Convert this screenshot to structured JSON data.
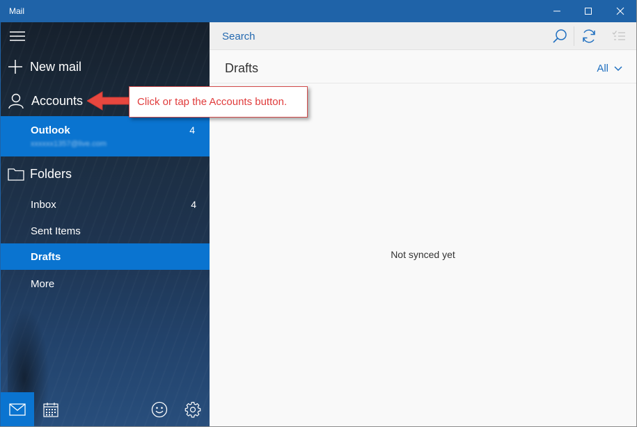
{
  "window": {
    "title": "Mail",
    "controls": [
      "minimize-icon",
      "maximize-icon",
      "close-icon"
    ]
  },
  "sidebar": {
    "menu_icon": "hamburger-icon",
    "new_mail": {
      "label": "New mail",
      "icon": "plus-icon"
    },
    "accounts": {
      "label": "Accounts",
      "icon": "person-icon"
    },
    "account": {
      "name": "Outlook",
      "email": "xxxxxx1357@live.com",
      "unread": "4"
    },
    "folders": {
      "label": "Folders",
      "icon": "folder-icon"
    },
    "folder_items": [
      {
        "label": "Inbox",
        "count": "4"
      },
      {
        "label": "Sent Items",
        "count": ""
      },
      {
        "label": "Drafts",
        "count": "",
        "selected": true
      },
      {
        "label": "More",
        "count": ""
      }
    ],
    "bottom_bar": [
      "mail-icon",
      "calendar-icon",
      "smiley-icon",
      "gear-icon"
    ]
  },
  "main": {
    "search": {
      "placeholder": "Search"
    },
    "folder_title": "Drafts",
    "filter": "All",
    "empty_message": "Not synced yet"
  },
  "callout": {
    "text": "Click or tap the Accounts button."
  },
  "colors": {
    "titlebar": "#1f63a8",
    "selected": "#0a74d0",
    "accent_text": "#1f6fc0",
    "callout_red": "#e03b3b"
  }
}
